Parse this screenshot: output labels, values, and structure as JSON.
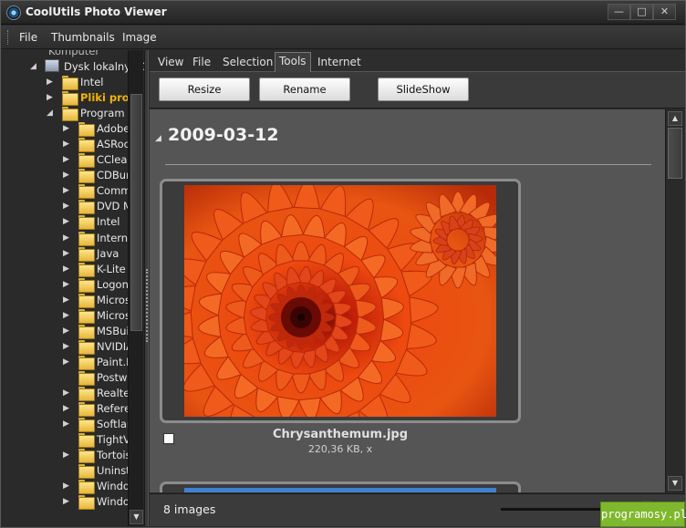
{
  "window": {
    "title": "CoolUtils Photo Viewer"
  },
  "title_buttons": {
    "menu": "—",
    "minimize": "—",
    "maximize": "□",
    "close": "✕"
  },
  "menubar": {
    "items": [
      "File",
      "Thumbnails",
      "Image"
    ]
  },
  "tree": {
    "top_partial": "Komputer",
    "drive": "Dysk lokalny (C",
    "items": [
      {
        "label": "Intel",
        "level": 1,
        "bold": false
      },
      {
        "label": "Pliki prog",
        "level": 1,
        "bold": true
      },
      {
        "label": "Program Fi",
        "level": 1,
        "bold": false,
        "expanded": true
      },
      {
        "label": "Adobe",
        "level": 2
      },
      {
        "label": "ASRock",
        "level": 2
      },
      {
        "label": "CClean",
        "level": 2
      },
      {
        "label": "CDBurn",
        "level": 2
      },
      {
        "label": "Commo",
        "level": 2
      },
      {
        "label": "DVD Ma",
        "level": 2
      },
      {
        "label": "Intel",
        "level": 2
      },
      {
        "label": "Interne",
        "level": 2
      },
      {
        "label": "Java",
        "level": 2
      },
      {
        "label": "K-Lite C",
        "level": 2
      },
      {
        "label": "Logon",
        "level": 2
      },
      {
        "label": "Microsc",
        "level": 2
      },
      {
        "label": "Microsc",
        "level": 2
      },
      {
        "label": "MSBuild",
        "level": 2
      },
      {
        "label": "NVIDIA",
        "level": 2
      },
      {
        "label": "Paint.N",
        "level": 2
      },
      {
        "label": "Postwc",
        "level": 2
      },
      {
        "label": "Realtel",
        "level": 2
      },
      {
        "label": "Refere",
        "level": 2
      },
      {
        "label": "Softlan",
        "level": 2
      },
      {
        "label": "TightVI",
        "level": 2
      },
      {
        "label": "Tortois",
        "level": 2
      },
      {
        "label": "Uninsta",
        "level": 2
      },
      {
        "label": "Windoŵ",
        "level": 2
      },
      {
        "label": "Windoŵ",
        "level": 2
      }
    ]
  },
  "tabs": [
    "View",
    "File",
    "Selection",
    "Tools",
    "Internet"
  ],
  "active_tab": "Tools",
  "toolbar": {
    "resize": "Resize",
    "rename": "Rename",
    "slideshow": "SlideShow"
  },
  "gallery": {
    "group_title": "2009-03-12",
    "items": [
      {
        "filename": "Chrysanthemum.jpg",
        "info": "220,36 KB, x"
      }
    ]
  },
  "status": {
    "count_text": "8 images"
  },
  "watermark": "programosy.pl",
  "colors": {
    "accent_folder": "#f0b400",
    "background": "#2b2b2b",
    "content": "#555555",
    "watermark": "#7fb72d"
  }
}
